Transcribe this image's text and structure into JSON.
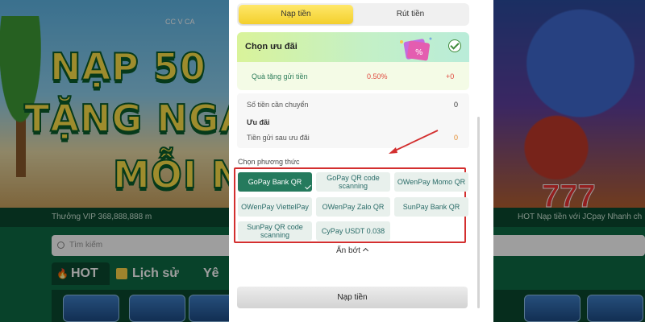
{
  "background": {
    "logo_text": "CC V CA",
    "banner_lines": [
      "NẠP 50",
      "TẶNG NGA",
      "MỖI N"
    ],
    "ticker_left": "Thưởng VIP 368,888,888 m",
    "ticker_right": "HOT Nạp tiền với JCpay Nhanh ch",
    "search_placeholder": "Tìm kiếm",
    "tabs": [
      "HOT",
      "Lịch sử",
      "Yê"
    ],
    "slot_text": "777"
  },
  "tabs": {
    "deposit": "Nạp tiền",
    "withdraw": "Rút tiền"
  },
  "promo": {
    "title": "Chọn ưu đãi",
    "item_name": "Quà tặng gửi tiền",
    "item_percent": "0.50%",
    "item_amount": "+0"
  },
  "summary": {
    "transfer_label": "Số tiền cần chuyển",
    "transfer_value": "0",
    "offer_label": "Ưu đãi",
    "after_label": "Tiền gửi sau ưu đãi",
    "after_value": "0"
  },
  "methods": {
    "label": "Chọn phương thức",
    "items": [
      {
        "label": "GoPay Bank QR",
        "active": true
      },
      {
        "label": "GoPay QR code scanning",
        "active": false
      },
      {
        "label": "OWenPay Momo QR",
        "active": false
      },
      {
        "label": "OWenPay ViettelPay",
        "active": false
      },
      {
        "label": "OWenPay Zalo QR",
        "active": false
      },
      {
        "label": "SunPay Bank QR",
        "active": false
      },
      {
        "label": "SunPay QR code scanning",
        "active": false
      },
      {
        "label": "CyPay USDT 0.038",
        "active": false
      }
    ]
  },
  "collapse_label": "Ẩn bớt",
  "submit_label": "Nạp tiền",
  "colors": {
    "accent_yellow": "#f3cf2c",
    "method_active": "#257a5d",
    "highlight_red": "#d32f2f",
    "offer_red": "#e0493f"
  }
}
